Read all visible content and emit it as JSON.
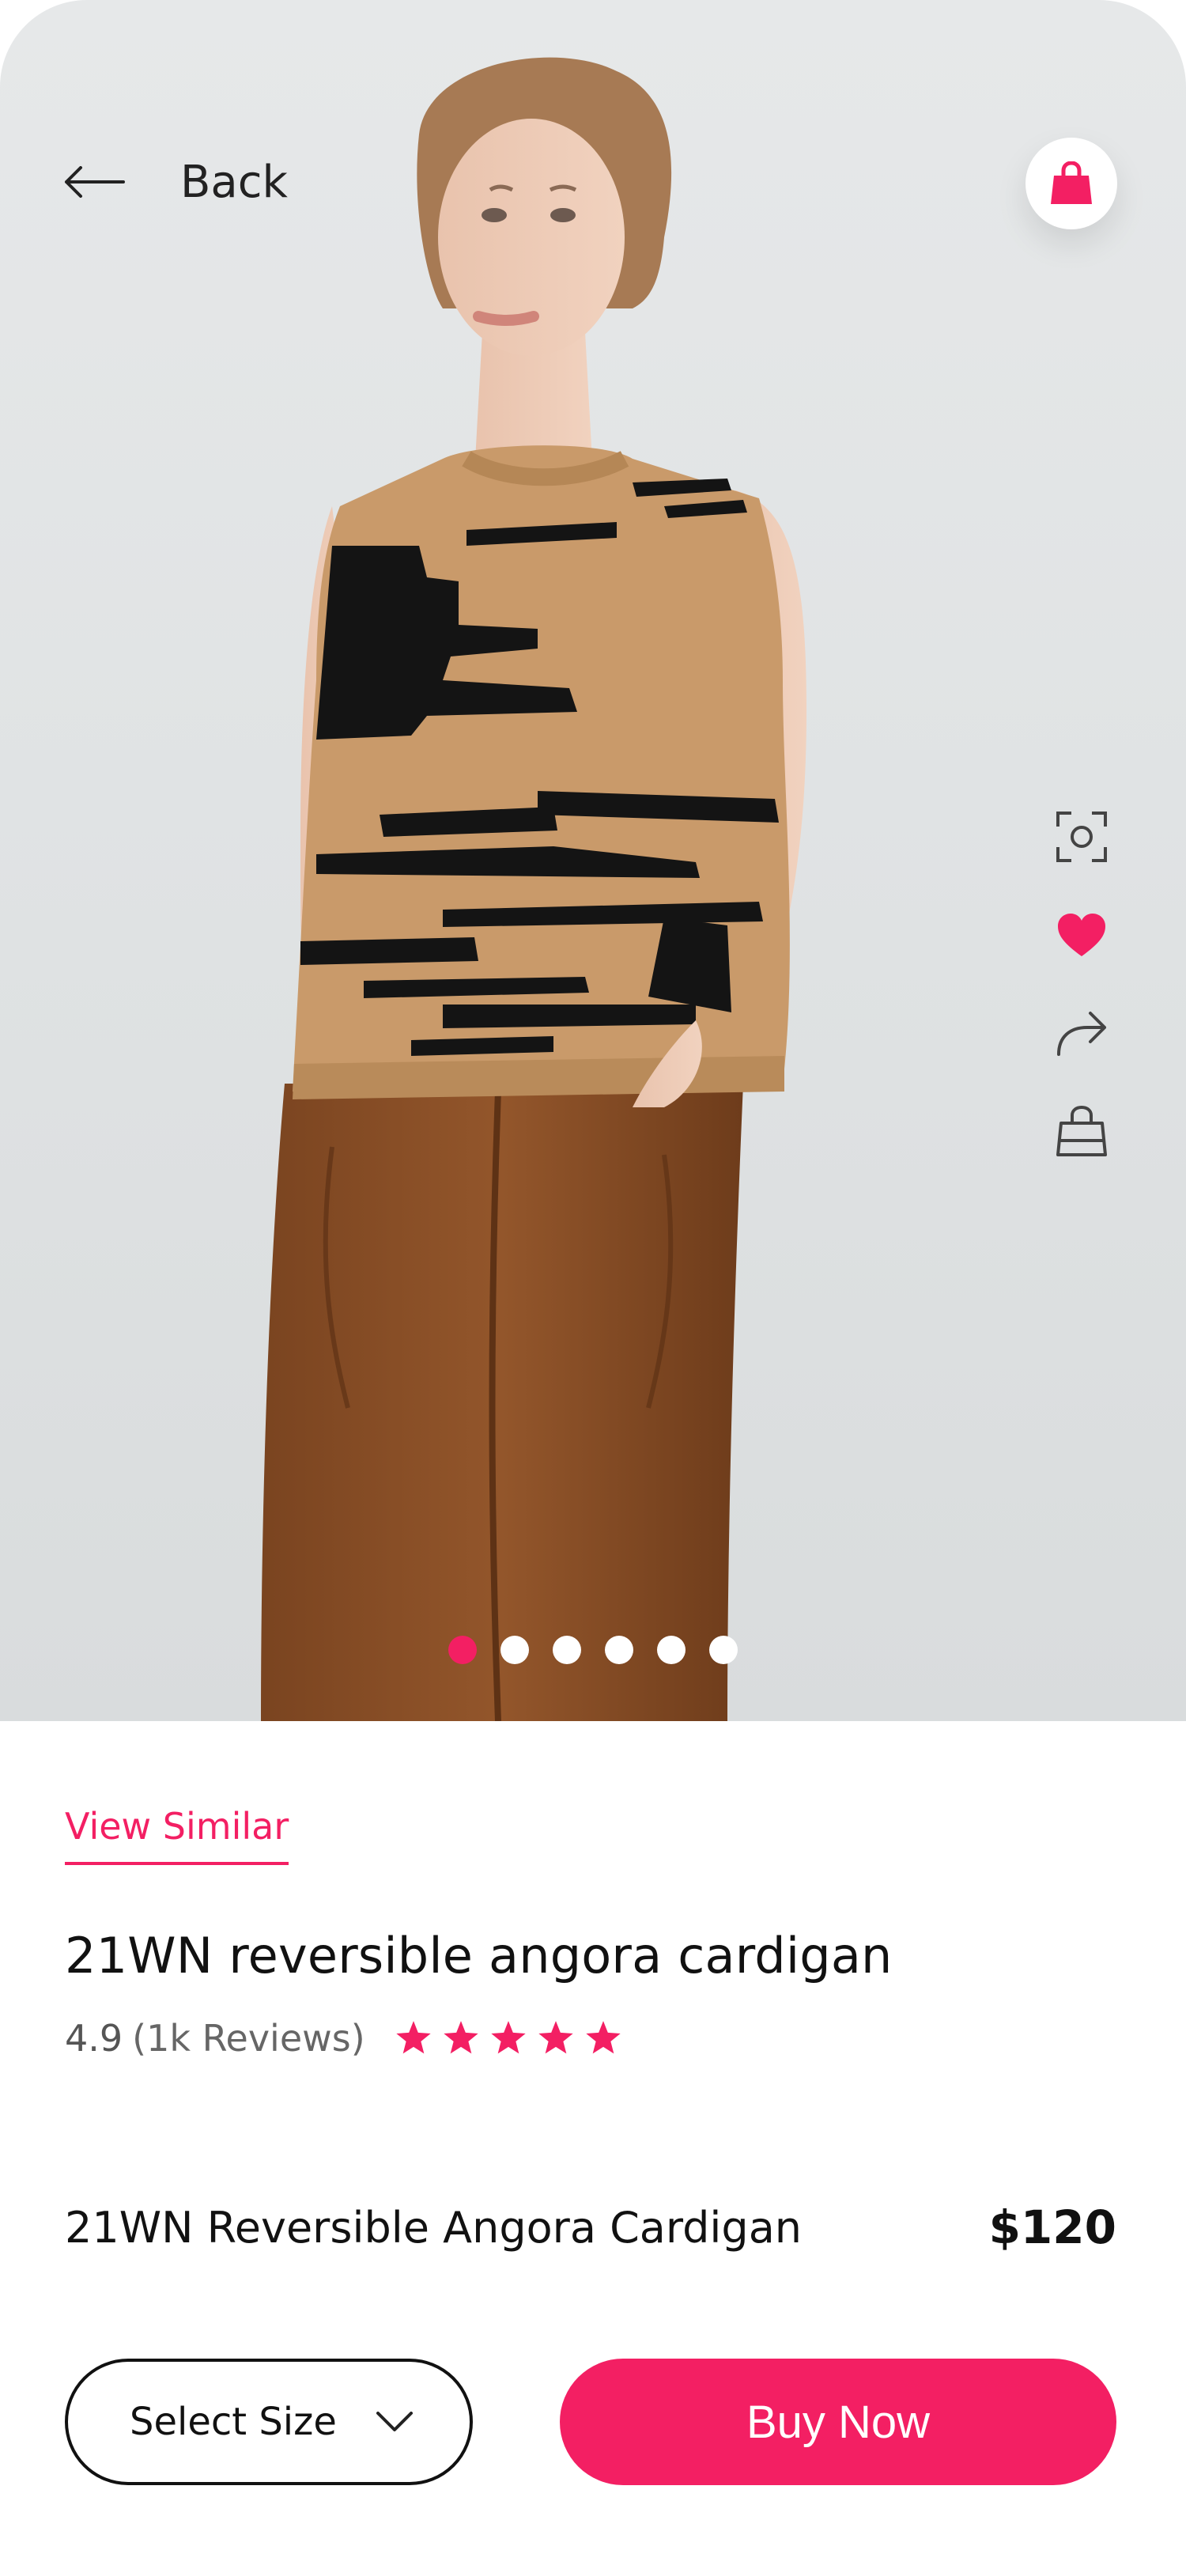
{
  "header": {
    "back_label": "Back",
    "back_icon": "arrow-left-icon",
    "cart_icon": "shopping-bag-icon"
  },
  "gallery": {
    "image_description_icon": "product-photo",
    "slide_count": 6,
    "active_slide": 1
  },
  "side_actions": [
    {
      "name": "visual-search-icon",
      "icon": "camera-scan"
    },
    {
      "name": "favorite-icon",
      "icon": "heart"
    },
    {
      "name": "share-icon",
      "icon": "share-arrow"
    },
    {
      "name": "bag-icon",
      "icon": "shopping-bag"
    }
  ],
  "product": {
    "view_similar": "View Similar",
    "title": "21WN reversible angora cardigan",
    "rating": "4.9",
    "reviews": "(1k Reviews)",
    "stars": 5,
    "full_name": "21WN Reversible Angora Cardigan",
    "price": "$120"
  },
  "actions": {
    "select_size": "Select Size",
    "buy_now": "Buy Now"
  },
  "colors": {
    "accent": "#f31f63",
    "text": "#111111",
    "muted": "#666666",
    "background": "#ffffff"
  }
}
